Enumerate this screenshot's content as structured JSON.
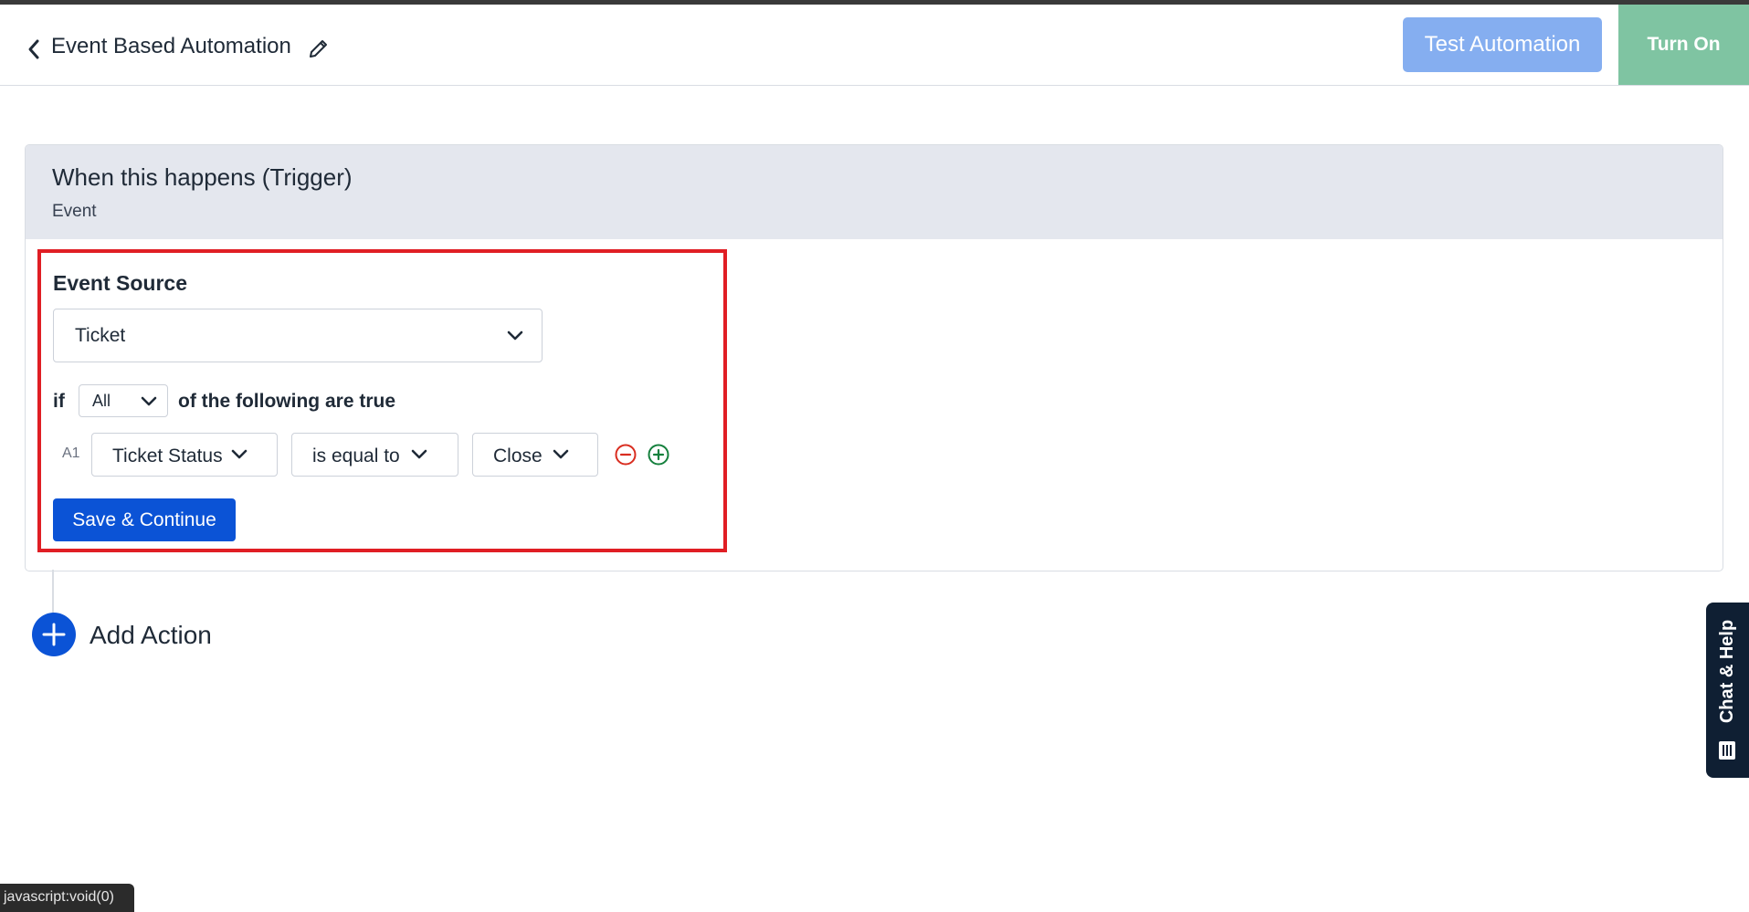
{
  "header": {
    "back_icon": "chevron-left-icon",
    "title": "Event Based Automation",
    "edit_icon": "pencil-icon",
    "test_button": "Test Automation",
    "turn_on_button": "Turn On"
  },
  "colors": {
    "primary": "#0b53d6",
    "test_button": "#85aef0",
    "turn_on": "#7fc4a2",
    "highlight": "#e01e24",
    "remove_icon": "#d92d20",
    "add_icon": "#15803d"
  },
  "trigger": {
    "title": "When this happens (Trigger)",
    "subtitle": "Event",
    "event_source_label": "Event Source",
    "event_source_value": "Ticket",
    "if_label": "if",
    "match_value": "All",
    "following_label": "of the following are true",
    "conditions": [
      {
        "id": "A1",
        "field": "Ticket Status",
        "operator": "is equal to",
        "value": "Close"
      }
    ],
    "save_button": "Save & Continue"
  },
  "actions": {
    "add_label": "Add Action"
  },
  "chat_widget": {
    "label": "Chat & Help"
  },
  "status_bar": {
    "text": "javascript:void(0)"
  }
}
